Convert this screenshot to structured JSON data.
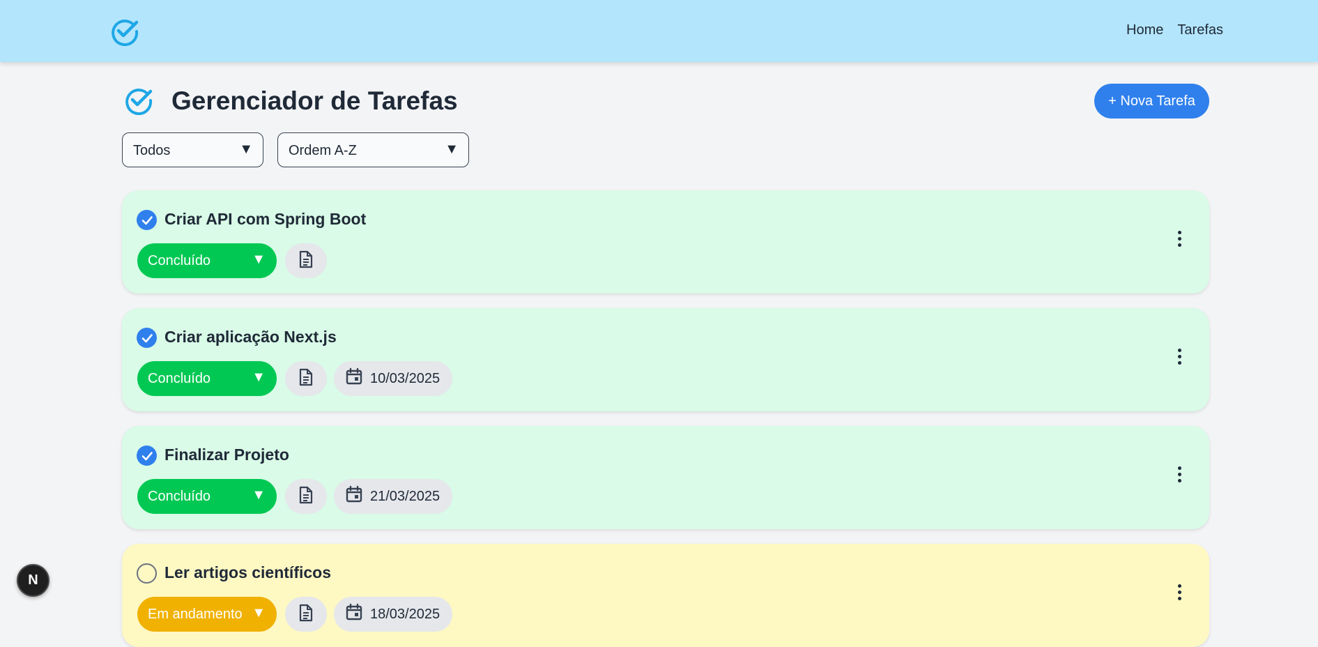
{
  "nav": {
    "logo_icon": "check-circle-icon",
    "links": [
      "Home",
      "Tarefas"
    ]
  },
  "header": {
    "title": "Gerenciador de Tarefas",
    "title_icon": "check-circle-icon",
    "new_task_label": "+ Nova Tarefa"
  },
  "filters": {
    "status_value": "Todos",
    "order_value": "Ordem A-Z",
    "arrow": "▼"
  },
  "tasks": [
    {
      "title": "Criar API com Spring Boot",
      "status": "Concluído",
      "completed": true,
      "date": ""
    },
    {
      "title": "Criar aplicação Next.js",
      "status": "Concluído",
      "completed": true,
      "date": "10/03/2025"
    },
    {
      "title": "Finalizar Projeto",
      "status": "Concluído",
      "completed": true,
      "date": "21/03/2025"
    },
    {
      "title": "Ler artigos científicos",
      "status": "Em andamento",
      "completed": false,
      "date": "18/03/2025"
    }
  ],
  "colors": {
    "navbar": "#b3e5fc",
    "accent": "#2f80ed",
    "done_card": "#d9fbe7",
    "progress_card": "#fef8c3",
    "done_status": "#00c853",
    "progress_status": "#f0b100",
    "logo": "#1ea7e6"
  },
  "dev_badge": {
    "label": "N",
    "icon": "nextjs-logo-icon"
  }
}
